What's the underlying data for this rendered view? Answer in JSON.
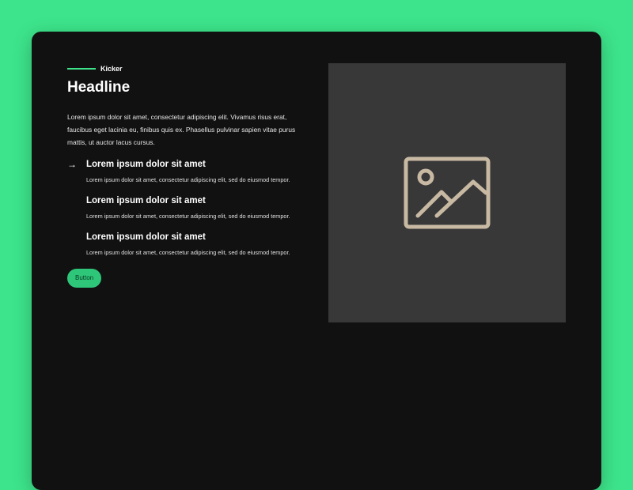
{
  "kicker": "Kicker",
  "headline": "Headline",
  "intro": "Lorem ipsum dolor sit amet, consectetur adipiscing elit. Vivamus risus erat, faucibus eget lacinia eu, finibus quis ex. Phasellus pulvinar sapien vitae purus mattis, ut auctor lacus cursus.",
  "items": [
    {
      "icon": "arrow-right-icon",
      "title": "Lorem ipsum dolor sit amet",
      "body": "Lorem ipsum dolor sit amet, consectetur adipiscing elit, sed do eiusmod tempor."
    },
    {
      "title": "Lorem ipsum dolor sit amet",
      "body": "Lorem ipsum dolor sit amet, consectetur adipiscing elit, sed do eiusmod tempor."
    },
    {
      "title": "Lorem ipsum dolor sit amet",
      "body": "Lorem ipsum dolor sit amet, consectetur adipiscing elit, sed do eiusmod tempor."
    }
  ],
  "button": "Button",
  "media": {
    "icon": "image-placeholder-icon"
  },
  "colors": {
    "accent": "#3de48b",
    "card_bg": "#111111",
    "media_bg": "#383838",
    "icon": "#c8b9a3"
  }
}
